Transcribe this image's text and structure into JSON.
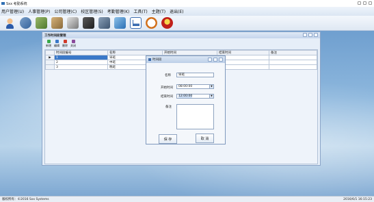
{
  "app": {
    "title": "Sxx 考勤系统"
  },
  "menu": [
    "用户管理(U)",
    "人事管理(P)",
    "公司管理(C)",
    "校区管理(S)",
    "考勤管理(K)",
    "工具(T)",
    "主题(T)",
    "退出(E)"
  ],
  "toolbar_icons": [
    "user-icon",
    "users-icon",
    "org-icon",
    "building-icon",
    "document-icon",
    "camera-icon",
    "money-icon",
    "grid-icon",
    "chart-icon",
    "clock-icon",
    "power-icon"
  ],
  "child_window": {
    "title": "工作时间段管理",
    "buttons": [
      "新增",
      "编辑",
      "删除",
      "关闭"
    ],
    "columns": [
      "时间段编号",
      "名称",
      "开始时间",
      "结束时间",
      "备注"
    ],
    "rows": [
      {
        "marker": "▶",
        "id": "1",
        "name": "早班",
        "start": "",
        "end": "",
        "note": ""
      },
      {
        "marker": "",
        "id": "2",
        "name": "中班",
        "start": "",
        "end": "",
        "note": ""
      },
      {
        "marker": "",
        "id": "3",
        "name": "晚班",
        "start": "",
        "end": "",
        "note": ""
      }
    ]
  },
  "dialog": {
    "title": "时间段",
    "name_label": "名称",
    "name_value": "早班",
    "start_label": "开始时间",
    "start_value": "08:00:00",
    "end_label": "结束时间",
    "end_value": "12:00:00",
    "note_label": "备注",
    "ok_label": "保 存",
    "cancel_label": "取 消"
  },
  "status": {
    "left": "版权所有：©2016 Sxx Systems",
    "right": "2016/6/1 16:15:23"
  }
}
